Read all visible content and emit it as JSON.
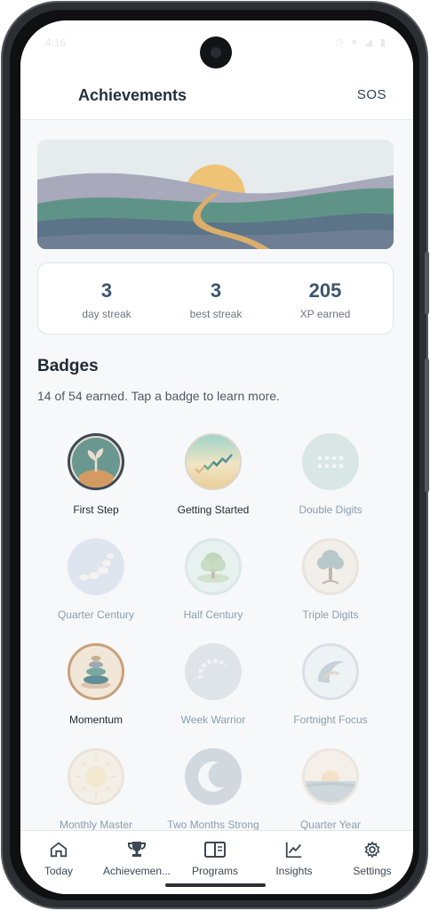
{
  "status": {
    "time": "4:16",
    "icons": "◷ ▾ ◢ ▮"
  },
  "appbar": {
    "title": "Achievements",
    "sos": "SOS"
  },
  "stats": [
    {
      "value": "3",
      "label": "day streak"
    },
    {
      "value": "3",
      "label": "best streak"
    },
    {
      "value": "205",
      "label": "XP earned"
    }
  ],
  "badges": {
    "title": "Badges",
    "subtitle": "14 of 54 earned. Tap a badge to learn more.",
    "items": [
      {
        "label": "First Step",
        "icon": "sprout-icon",
        "earned": true
      },
      {
        "label": "Getting Started",
        "icon": "checkmarks-icon",
        "earned": true
      },
      {
        "label": "Double Digits",
        "icon": "dots-icon",
        "earned": false
      },
      {
        "label": "Quarter Century",
        "icon": "pebbles-icon",
        "earned": false
      },
      {
        "label": "Half Century",
        "icon": "tree-icon",
        "earned": false
      },
      {
        "label": "Triple Digits",
        "icon": "big-tree-icon",
        "earned": false
      },
      {
        "label": "Momentum",
        "icon": "stacked-stones-icon",
        "earned": true
      },
      {
        "label": "Week Warrior",
        "icon": "arc-icon",
        "earned": false
      },
      {
        "label": "Fortnight Focus",
        "icon": "wave-moon-icon",
        "earned": false
      },
      {
        "label": "Monthly Master",
        "icon": "sun-icon",
        "earned": false
      },
      {
        "label": "Two Months Strong",
        "icon": "crescent-moon-icon",
        "earned": false
      },
      {
        "label": "Quarter Year",
        "icon": "sunrise-icon",
        "earned": false
      }
    ]
  },
  "nav": [
    {
      "label": "Today",
      "icon": "home-icon"
    },
    {
      "label": "Achievemen...",
      "icon": "trophy-icon"
    },
    {
      "label": "Programs",
      "icon": "book-icon"
    },
    {
      "label": "Insights",
      "icon": "chart-icon"
    },
    {
      "label": "Settings",
      "icon": "gear-icon"
    }
  ]
}
